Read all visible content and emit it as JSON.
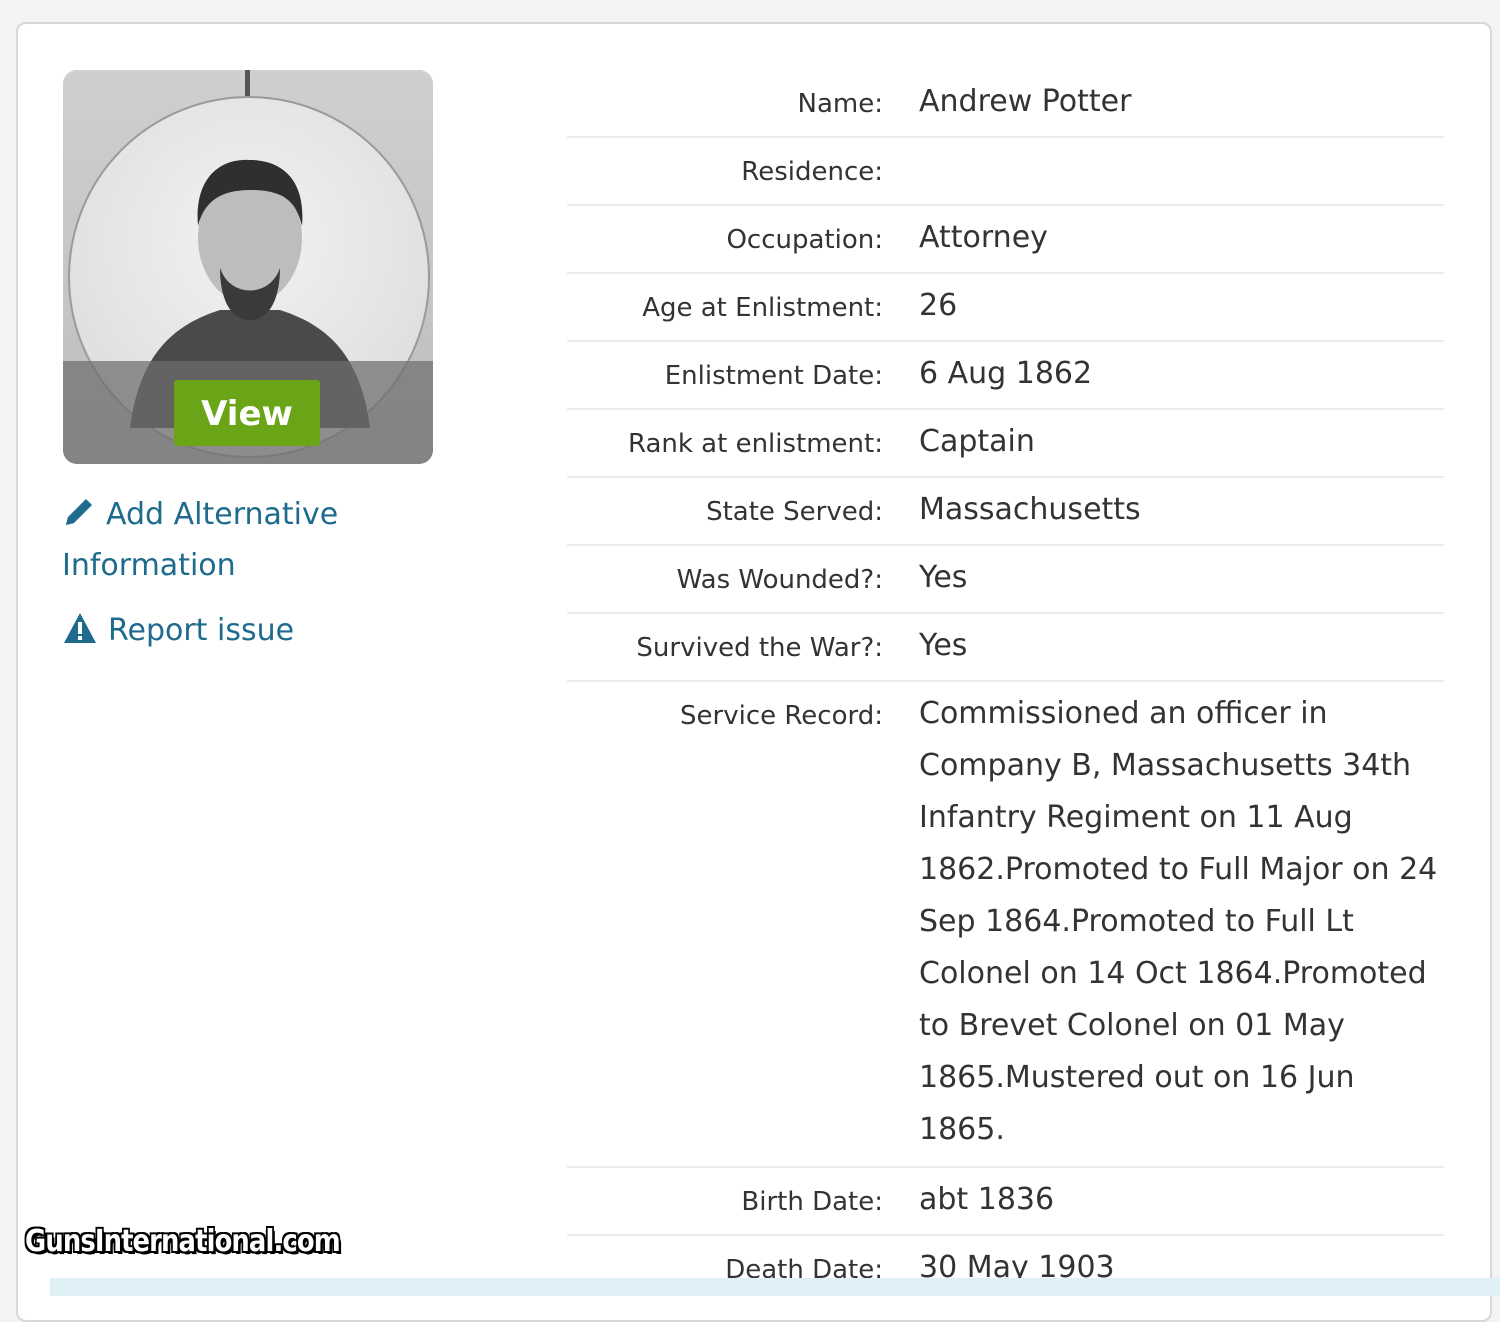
{
  "photo": {
    "view_label": "View"
  },
  "links": {
    "add_alternative": "Add Alternative Information",
    "report_issue": "Report issue"
  },
  "details": [
    {
      "label": "Name:",
      "value": "Andrew Potter"
    },
    {
      "label": "Residence:",
      "value": ""
    },
    {
      "label": "Occupation:",
      "value": "Attorney"
    },
    {
      "label": "Age at Enlistment:",
      "value": "26"
    },
    {
      "label": "Enlistment Date:",
      "value": "6 Aug 1862"
    },
    {
      "label": "Rank at enlistment:",
      "value": "Captain"
    },
    {
      "label": "State Served:",
      "value": "Massachusetts"
    },
    {
      "label": "Was Wounded?:",
      "value": "Yes"
    },
    {
      "label": "Survived the War?:",
      "value": "Yes"
    },
    {
      "label": "Service Record:",
      "value": "Commissioned an officer in Company B, Massachusetts 34th Infantry Regiment on 11 Aug 1862.Promoted to Full Major on 24 Sep 1864.Promoted to Full Lt Colonel on 14 Oct 1864.Promoted to Brevet Colonel on 01 May 1865.Mustered out on 16 Jun 1865."
    },
    {
      "label": "Birth Date:",
      "value": "abt 1836"
    },
    {
      "label": "Death Date:",
      "value": "30 May 1903"
    }
  ],
  "watermark": "GunsInternational.com",
  "colors": {
    "link": "#1f6b8e",
    "view_button": "#6aa518"
  },
  "icons": {
    "add_alternative": "pencil-icon",
    "report_issue": "warning-icon"
  }
}
